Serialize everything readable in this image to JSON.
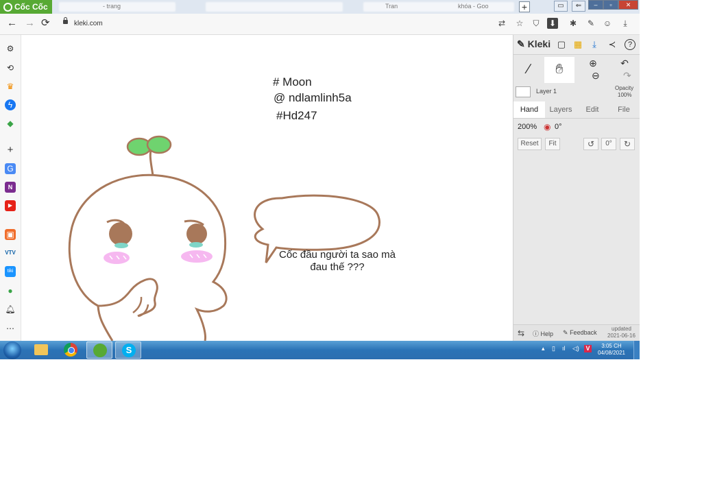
{
  "browser": {
    "brand": "Cốc Cốc",
    "tabs": [
      "- trang",
      "Tran",
      "khóa - Goo"
    ],
    "url": "kleki.com",
    "new_tab_label": "+",
    "nav": {
      "back": "←",
      "forward": "→",
      "reload": "⟳"
    }
  },
  "canvas": {
    "hashtags": [
      "# Moon",
      "@ ndlamlinh5a",
      "#Hd247"
    ],
    "speech_bubble": "Cốc đầu người ta sao mà đau thế ???"
  },
  "kleki": {
    "logo": "Kleki",
    "layer_name": "Layer 1",
    "opacity_label": "Opacity",
    "opacity_value": "100%",
    "tabs": [
      "Hand",
      "Layers",
      "Edit",
      "File"
    ],
    "active_tab": "Hand",
    "zoom": "200%",
    "rotation": "0°",
    "buttons": {
      "reset": "Reset",
      "fit": "Fit",
      "zero": "0°"
    },
    "footer": {
      "help": "Help",
      "feedback": "Feedback",
      "updated_label": "updated",
      "updated_date": "2021-06-16"
    }
  },
  "taskbar": {
    "time": "3:05 CH",
    "date": "04/08/2021"
  },
  "colors": {
    "brand_green": "#57a934",
    "character_outline": "#a8785a",
    "sprout": "#6fd36f",
    "blush": "#f6b8f0",
    "tear": "#7fd6c8",
    "taskbar": "#2b73b6"
  },
  "icons": {
    "sidebar": [
      "gear-icon",
      "history-icon",
      "crown-icon",
      "messenger-icon",
      "game-icon",
      "add-icon",
      "translate-icon",
      "onenote-icon",
      "youtube-icon",
      "store-icon",
      "vtv-icon",
      "tiki-icon",
      "extension-icon",
      "bell-icon",
      "more-icon"
    ]
  }
}
